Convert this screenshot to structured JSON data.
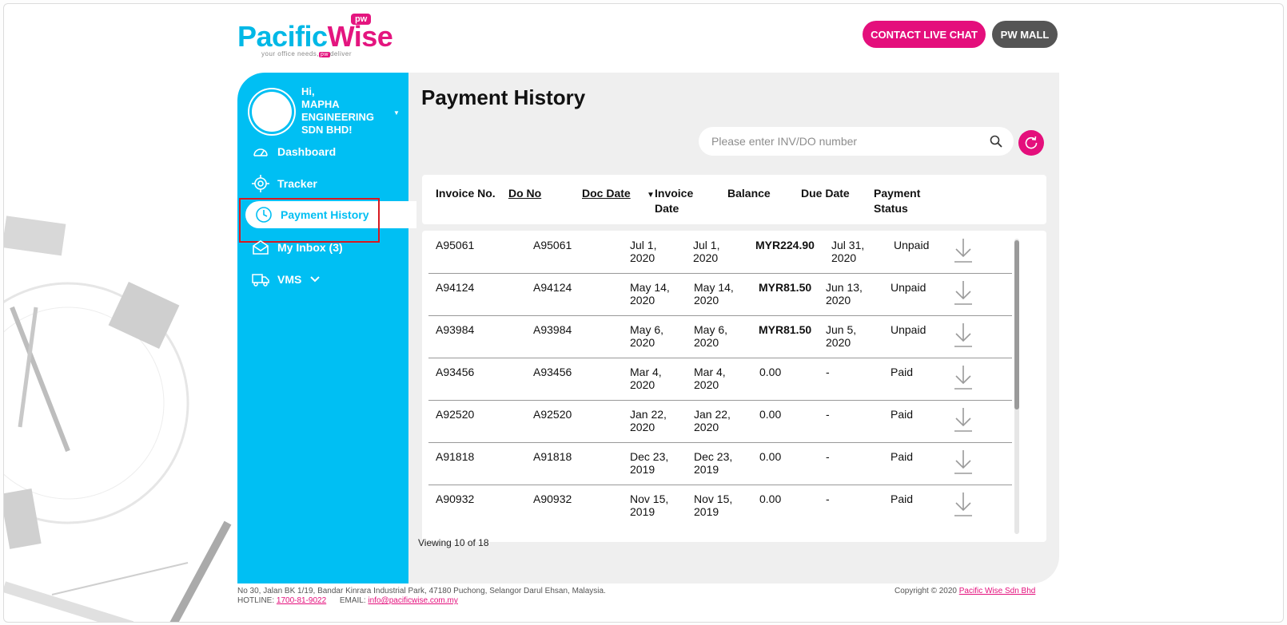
{
  "header": {
    "logo_text_a": "Pac",
    "logo_text_b": "ific",
    "logo_text_c": "Wise",
    "logo_badge": "pw",
    "logo_tagline_a": "your office needs,",
    "logo_tagline_pw": "pw",
    "logo_tagline_b": "deliver",
    "contact_label": "CONTACT LIVE CHAT",
    "mall_label": "PW MALL"
  },
  "user": {
    "greeting_line1": "Hi,",
    "greeting_line2": "MAPHA",
    "greeting_line3": "ENGINEERING",
    "greeting_line4": "SDN BHD!"
  },
  "sidebar": {
    "items": [
      {
        "label": "Dashboard",
        "icon": "speedometer-icon"
      },
      {
        "label": "Tracker",
        "icon": "target-icon"
      },
      {
        "label": "Payment History",
        "icon": "clock-icon",
        "active": true
      },
      {
        "label": "My Inbox (3)",
        "icon": "envelope-icon"
      },
      {
        "label": "VMS",
        "icon": "truck-icon"
      }
    ]
  },
  "page": {
    "title": "Payment History",
    "search_placeholder": "Please enter INV/DO number",
    "viewing": "Viewing 10 of 18"
  },
  "table": {
    "headers": {
      "invoice_no": "Invoice No.",
      "do_no": "Do No",
      "doc_date": "Doc Date",
      "invoice_date_1": "Invoice",
      "invoice_date_2": "Date",
      "balance": "Balance",
      "due_date": "Due Date",
      "payment_status_1": "Payment",
      "payment_status_2": "Status"
    },
    "rows": [
      {
        "inv": "A95061",
        "do": "A95061",
        "doc1": "Jul 1,",
        "doc2": "2020",
        "invd1": "Jul 1,",
        "invd2": "2020",
        "balance": "MYR224.90",
        "due1": "Jul 31,",
        "due2": "2020",
        "status": "Unpaid"
      },
      {
        "inv": "A94124",
        "do": "A94124",
        "doc1": "May 14,",
        "doc2": "2020",
        "invd1": "May 14,",
        "invd2": "2020",
        "balance": "MYR81.50",
        "due1": "Jun 13,",
        "due2": "2020",
        "status": "Unpaid"
      },
      {
        "inv": "A93984",
        "do": "A93984",
        "doc1": "May 6,",
        "doc2": "2020",
        "invd1": "May 6,",
        "invd2": "2020",
        "balance": "MYR81.50",
        "due1": "Jun 5,",
        "due2": "2020",
        "status": "Unpaid"
      },
      {
        "inv": "A93456",
        "do": "A93456",
        "doc1": "Mar 4,",
        "doc2": "2020",
        "invd1": "Mar 4,",
        "invd2": "2020",
        "balance": "0.00",
        "due1": "-",
        "due2": "",
        "status": "Paid"
      },
      {
        "inv": "A92520",
        "do": "A92520",
        "doc1": "Jan 22,",
        "doc2": "2020",
        "invd1": "Jan 22,",
        "invd2": "2020",
        "balance": "0.00",
        "due1": "-",
        "due2": "",
        "status": "Paid"
      },
      {
        "inv": "A91818",
        "do": "A91818",
        "doc1": "Dec 23,",
        "doc2": "2019",
        "invd1": "Dec 23,",
        "invd2": "2019",
        "balance": "0.00",
        "due1": "-",
        "due2": "",
        "status": "Paid"
      },
      {
        "inv": "A90932",
        "do": "A90932",
        "doc1": "Nov 15,",
        "doc2": "2019",
        "invd1": "Nov 15,",
        "invd2": "2019",
        "balance": "0.00",
        "due1": "-",
        "due2": "",
        "status": "Paid"
      }
    ]
  },
  "footer": {
    "address": "No 30, Jalan BK 1/19, Bandar Kinrara Industrial Park, 47180 Puchong, Selangor Darul Ehsan, Malaysia.",
    "hotline_label": "HOTLINE:",
    "hotline": "1700-81-9022",
    "email_label": "EMAIL:",
    "email": "info@pacificwise.com.my",
    "copyright": "Copyright © 2020",
    "company": "Pacific Wise Sdn Bhd"
  },
  "colors": {
    "brand_blue": "#00bff3",
    "brand_pink": "#e40f7c",
    "highlight_red": "#d71920"
  }
}
